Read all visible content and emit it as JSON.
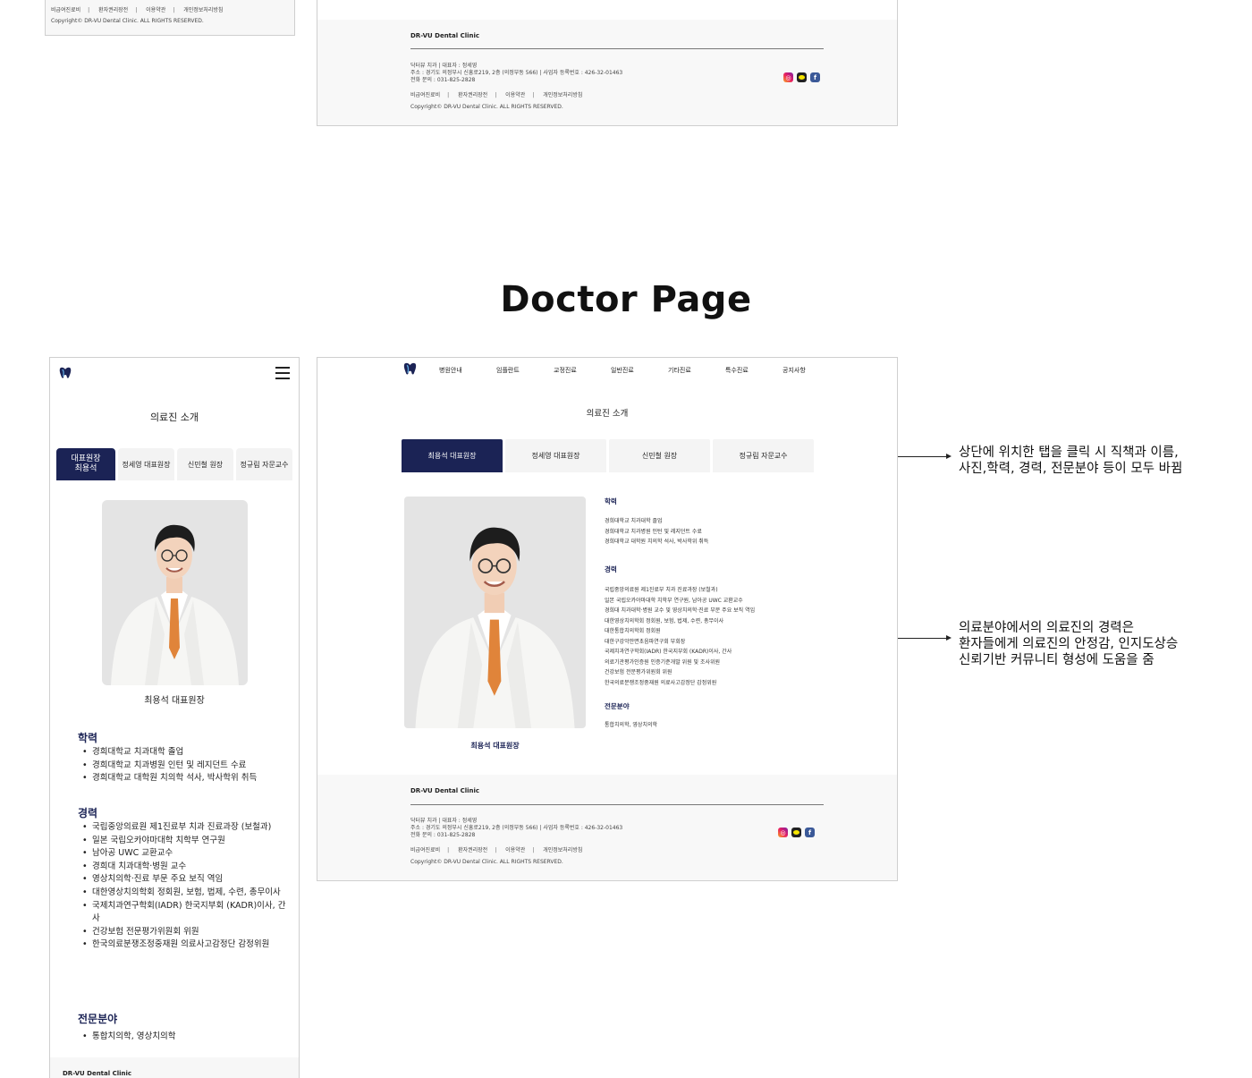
{
  "section_title": "Doctor Page",
  "clinic_name": "DR-VU Dental Clinic",
  "footer": {
    "info_line1": "닥터뷰 치과 | 대표자 : 정세영",
    "info_line2": "주소 : 경기도 의정부시 신흥로219, 2층 (의정부동 566) | 사업자 등록번호 : 426-32-01463",
    "info_line3": "전화 문의 : 031-825-2828",
    "links": [
      "비급여진료비",
      "환자권리장전",
      "이용약관",
      "개인정보처리방침"
    ],
    "copyright": "Copyright© DR-VU Dental Clinic. ALL RIGHTS RESERVED."
  },
  "page_title": "의료진 소개",
  "nav": [
    "병원안내",
    "임플란트",
    "교정진료",
    "일반진료",
    "기타진료",
    "특수진료",
    "공지사항"
  ],
  "mobile_tabs": [
    "대표원장\n최용석",
    "정세영 대표원장",
    "신민철 원장",
    "정규림 자문교수"
  ],
  "desktop_tabs": [
    "최용석 대표원장",
    "정세영 대표원장",
    "신민철 원장",
    "정규림 자문교수"
  ],
  "doctor": {
    "caption": "최용석 대표원장",
    "education_title": "학력",
    "education": [
      "경희대학교 치과대학 졸업",
      "경희대학교 치과병원 인턴 및 레지던트 수료",
      "경희대학교 대학원 치의학 석사, 박사학위 취득"
    ],
    "career_title": "경력",
    "career_mobile": [
      "국립중앙의료원 제1진료부 치과 진료과장 (보철과)",
      "일본 국립오카야마대학 치학부 연구원",
      "남아공 UWC 교환교수",
      "경희대 치과대학·병원 교수",
      "영상치의학·진료 부문 주요 보직 역임",
      "대한영상치의학회 정회원, 보험, 법제, 수련, 총무이사",
      "국제치과연구학회(IADR) 한국지부회 (KADR)이사, 간사",
      "건강보험 전문평가위원회 위원",
      "한국의료분쟁조정중재원 의료사고감정단 감정위원"
    ],
    "career_desktop": [
      "국립중앙의료원 제1진료부 치과 진료과장 (보철과)",
      "일본 국립오카야마대학 치학부 연구원, 남아공 UWC 교환교수",
      "경희대 치과대학·병원 교수 및 영상치의학·진료 부문 주요 보직 역임",
      "대한영상치의학회 정회원, 보험, 법제, 수련, 총무이사",
      "대한통합치의학회 정회원",
      "대한구강악안면초음파연구회 부회장",
      "국제치과연구학회(IADR) 한국지부회 (KADR)이사, 간사",
      "의료기관평가인증원 인증기준개발 위원 및 조사위원",
      "건강보험 전문평가위원회 위원",
      "한국의료분쟁조정중재원 의료사고감정단 감정위원"
    ],
    "specialty_title": "전문분야",
    "specialty": [
      "통합치의학, 영상치의학"
    ]
  },
  "annotations": {
    "tabs_note": "상단에 위치한 탭을 클릭 시 직책과 이름,\n사진,학력, 경력, 전문분야 등이 모두 바뀜",
    "career_note": "의료분야에서의 의료진의 경력은\n환자들에게 의료진의 안정감, 인지도상승\n신뢰기반 커뮤니티 형성에 도움을 줌"
  },
  "colors": {
    "navy": "#1b2355",
    "footer_bg": "#f8f8f8",
    "tab_bg": "#f4f4f4"
  },
  "icons": [
    "tooth-logo-icon",
    "hamburger-menu-icon",
    "instagram-icon",
    "kakao-icon",
    "facebook-icon"
  ]
}
